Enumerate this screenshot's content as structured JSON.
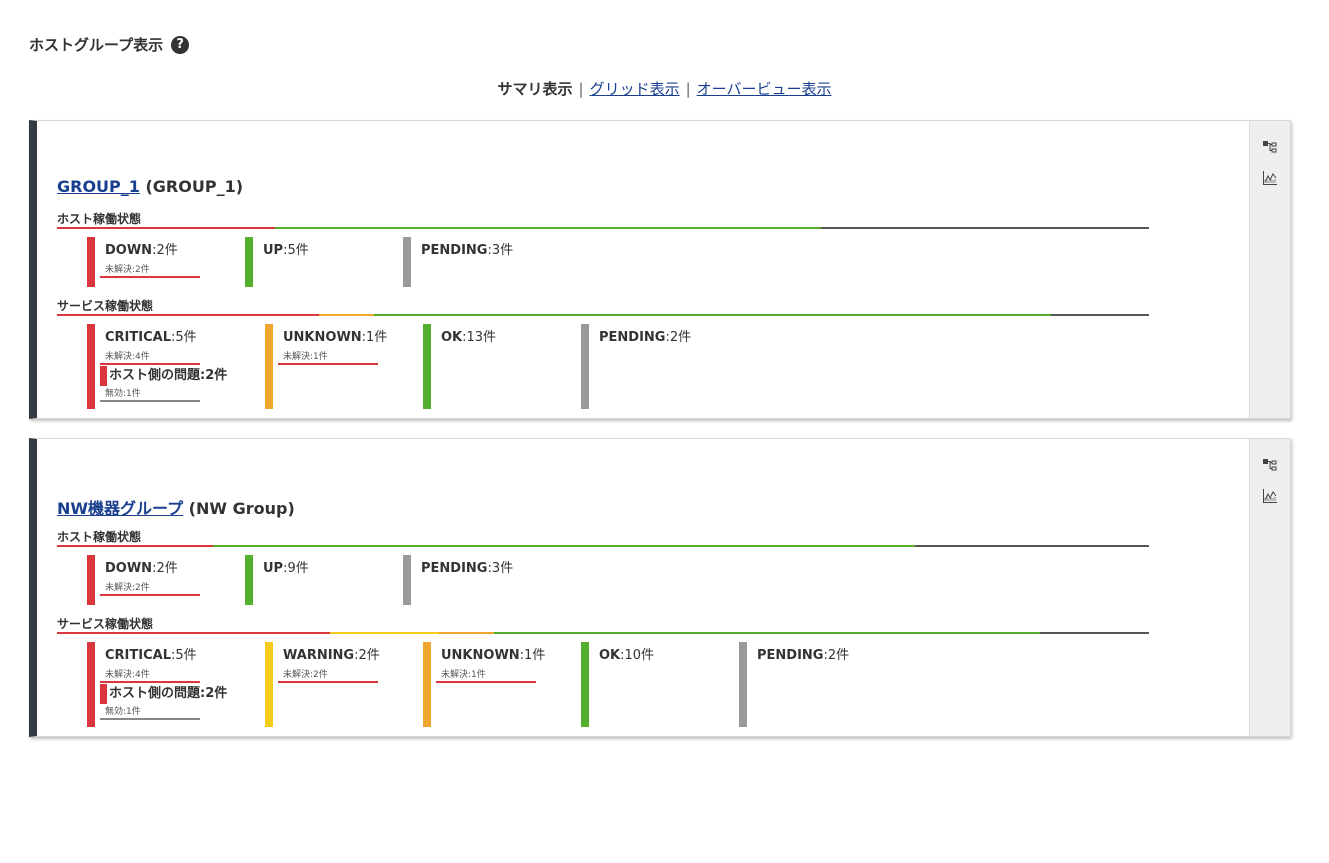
{
  "page": {
    "title": "ホストグループ表示",
    "help": "?"
  },
  "views": {
    "current": "サマリ表示",
    "separator": "|",
    "grid": "グリッド表示",
    "overview": "オーバービュー表示"
  },
  "colors": {
    "down": "#d9363e",
    "up": "#52ae2b",
    "pending": "#999999",
    "critical": "#d9363e",
    "warning": "#f5cc1b",
    "unknown": "#f0a52f",
    "ok": "#52ae2b",
    "bar_end": "#555555"
  },
  "groups": [
    {
      "name": "GROUP_1",
      "alias": "(GROUP_1)",
      "host_label": "ホスト稼働状態",
      "service_label": "サービス稼働状態",
      "host_tiles": [
        {
          "status": "DOWN",
          "count": ":2件",
          "sub": "未解決:2件"
        },
        {
          "status": "UP",
          "count": ":5件"
        },
        {
          "status": "PENDING",
          "count": ":3件"
        }
      ],
      "service_tiles": [
        {
          "status": "CRITICAL",
          "count": ":5件",
          "sub": "未解決:4件",
          "host_problem": "ホスト側の問題:2件",
          "disabled": "無効:1件"
        },
        {
          "status": "UNKNOWN",
          "count": ":1件",
          "sub": "未解決:1件"
        },
        {
          "status": "OK",
          "count": ":13件"
        },
        {
          "status": "PENDING",
          "count": ":2件"
        }
      ]
    },
    {
      "name": "NW機器グループ",
      "alias": "(NW Group)",
      "host_label": "ホスト稼働状態",
      "service_label": "サービス稼働状態",
      "host_tiles": [
        {
          "status": "DOWN",
          "count": ":2件",
          "sub": "未解決:2件"
        },
        {
          "status": "UP",
          "count": ":9件"
        },
        {
          "status": "PENDING",
          "count": ":3件"
        }
      ],
      "service_tiles": [
        {
          "status": "CRITICAL",
          "count": ":5件",
          "sub": "未解決:4件",
          "host_problem": "ホスト側の問題:2件",
          "disabled": "無効:1件"
        },
        {
          "status": "WARNING",
          "count": ":2件",
          "sub": "未解決:2件"
        },
        {
          "status": "UNKNOWN",
          "count": ":1件",
          "sub": "未解決:1件"
        },
        {
          "status": "OK",
          "count": ":10件"
        },
        {
          "status": "PENDING",
          "count": ":2件"
        }
      ]
    }
  ]
}
